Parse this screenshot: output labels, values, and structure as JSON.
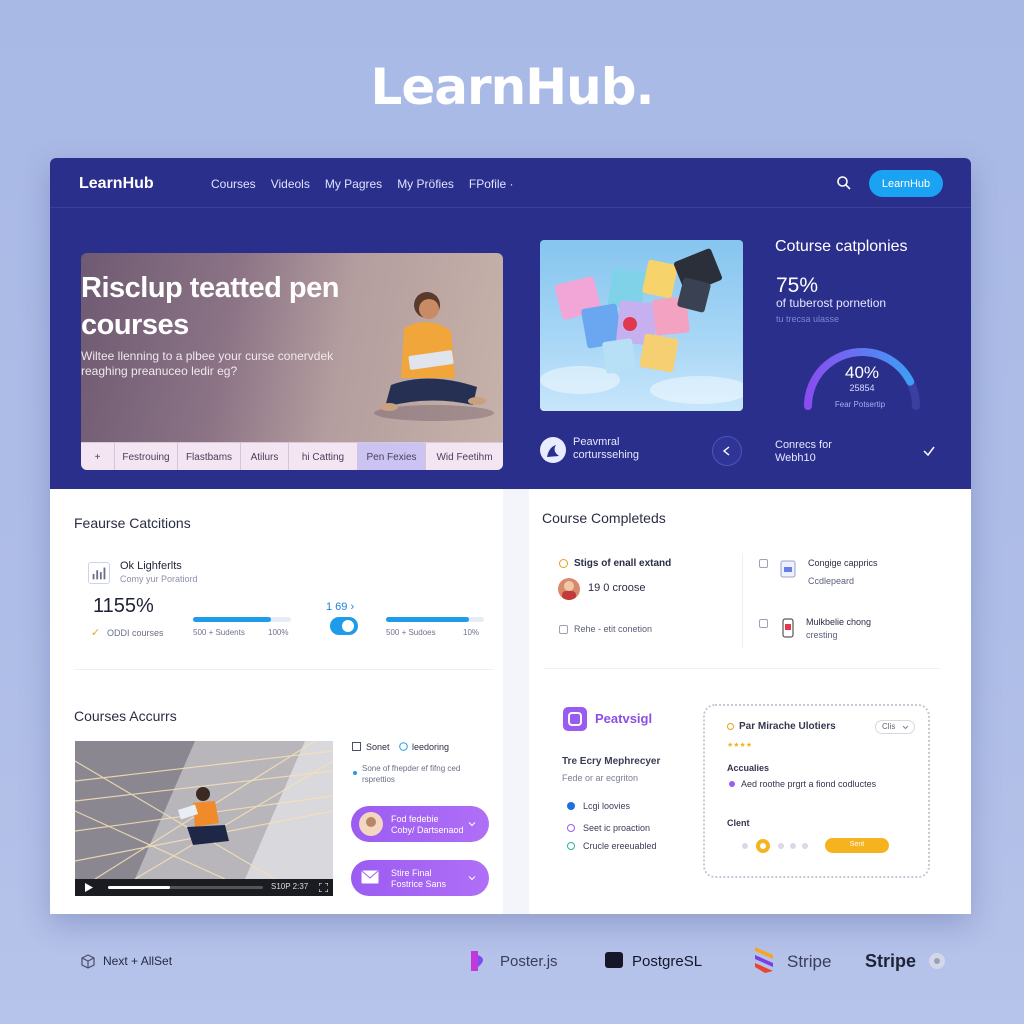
{
  "brand": {
    "title": "LearnHub."
  },
  "nav": {
    "logo": "LearnHub",
    "links": [
      "Courses",
      "Videols",
      "My Pagres",
      "My Pröfies",
      "FPofile ·"
    ],
    "cta": "LearnHub"
  },
  "hero": {
    "headline": "Risclup teatted pen courses",
    "subtitle": "Wiltee llenning to a plbee your curse conervdek reaghing preanuceo ledir eg?",
    "tabs": [
      "+",
      "Festrouing",
      "Flastbams",
      "Atilurs",
      "hi Catting",
      "Pen Fexies",
      "Wid Feetihm"
    ],
    "active_tab": 5
  },
  "feature": {
    "line1": "Peavmral",
    "line2": "corturssehing"
  },
  "stats": {
    "title": "Coturse catplonies",
    "percent": "75%",
    "percent_label": "of tuberost pornetion",
    "percent_sub": "tu trecsa ulasse",
    "gauge_value": "40%",
    "gauge_label": "25854",
    "gauge_sub": "Fear Potsertip",
    "gauge_fraction": 0.4,
    "connect_line1": "Conrecs for",
    "connect_line2": "Webh10"
  },
  "feature_collections": {
    "title": "Feaurse Catcitions",
    "name": "Ok Lighferlts",
    "sub": "Comy yur Poratiord",
    "big_value": "1155%",
    "courses": "ODDI courses",
    "mid_value": "1 69 ›",
    "bar1": {
      "label": "500 + Sudents",
      "pct": "100%",
      "fill": 0.8
    },
    "bar2": {
      "label": "500 + Sudoes",
      "pct": "10%",
      "fill": 0.85
    }
  },
  "course_completed": {
    "title": "Course Completeds",
    "item1": "Stigs of enall extand",
    "item1_value": "19 0 croose",
    "item2": "Rehe - etit conetion",
    "item3": "Congige capprics",
    "item3_sub": "Ccdlepeard",
    "item4": "Mulkbelie chong",
    "item4_sub": "cresting"
  },
  "courses_accurrs": {
    "title": "Courses Accurrs",
    "legend1": "Sonet",
    "legend2": "leedoring",
    "legend_desc": "Sone of fhepder ef fifng ced rsprettios",
    "video_time": "S10P 2:37",
    "pill1_line1": "Fod fedebie",
    "pill1_line2": "Coby/ Dartsenaod",
    "pill2_line1": "Stire Final",
    "pill2_line2": "Fostrice Sans"
  },
  "pv": {
    "name": "Peatvsigl",
    "subtitle": "Tre Ecry Mephrecyer",
    "desc": "Fede or ar ecgriton",
    "row1": "Lcgi loovies",
    "row2": "Seet ic proaction",
    "row3": "Crucle ereeuabled",
    "card_title": "Par Mirache Ulotiers",
    "card_select": "Clis",
    "card_stars": "★★★★",
    "card_section": "Accualies",
    "card_item": "Aed roothe prgrt a fiond codluctes",
    "card_client": "Clent",
    "card_btn": "Sent"
  },
  "footer": {
    "left": "Next + AllSet",
    "brands": [
      "Poster.js",
      "PostgreSL",
      "Stripe",
      "Stripe"
    ]
  },
  "colors": {
    "band": "#2b2f8c",
    "accent_blue": "#1aa3f2",
    "accent_purple": "#9b5cf2",
    "accent_orange": "#f5b41f"
  }
}
